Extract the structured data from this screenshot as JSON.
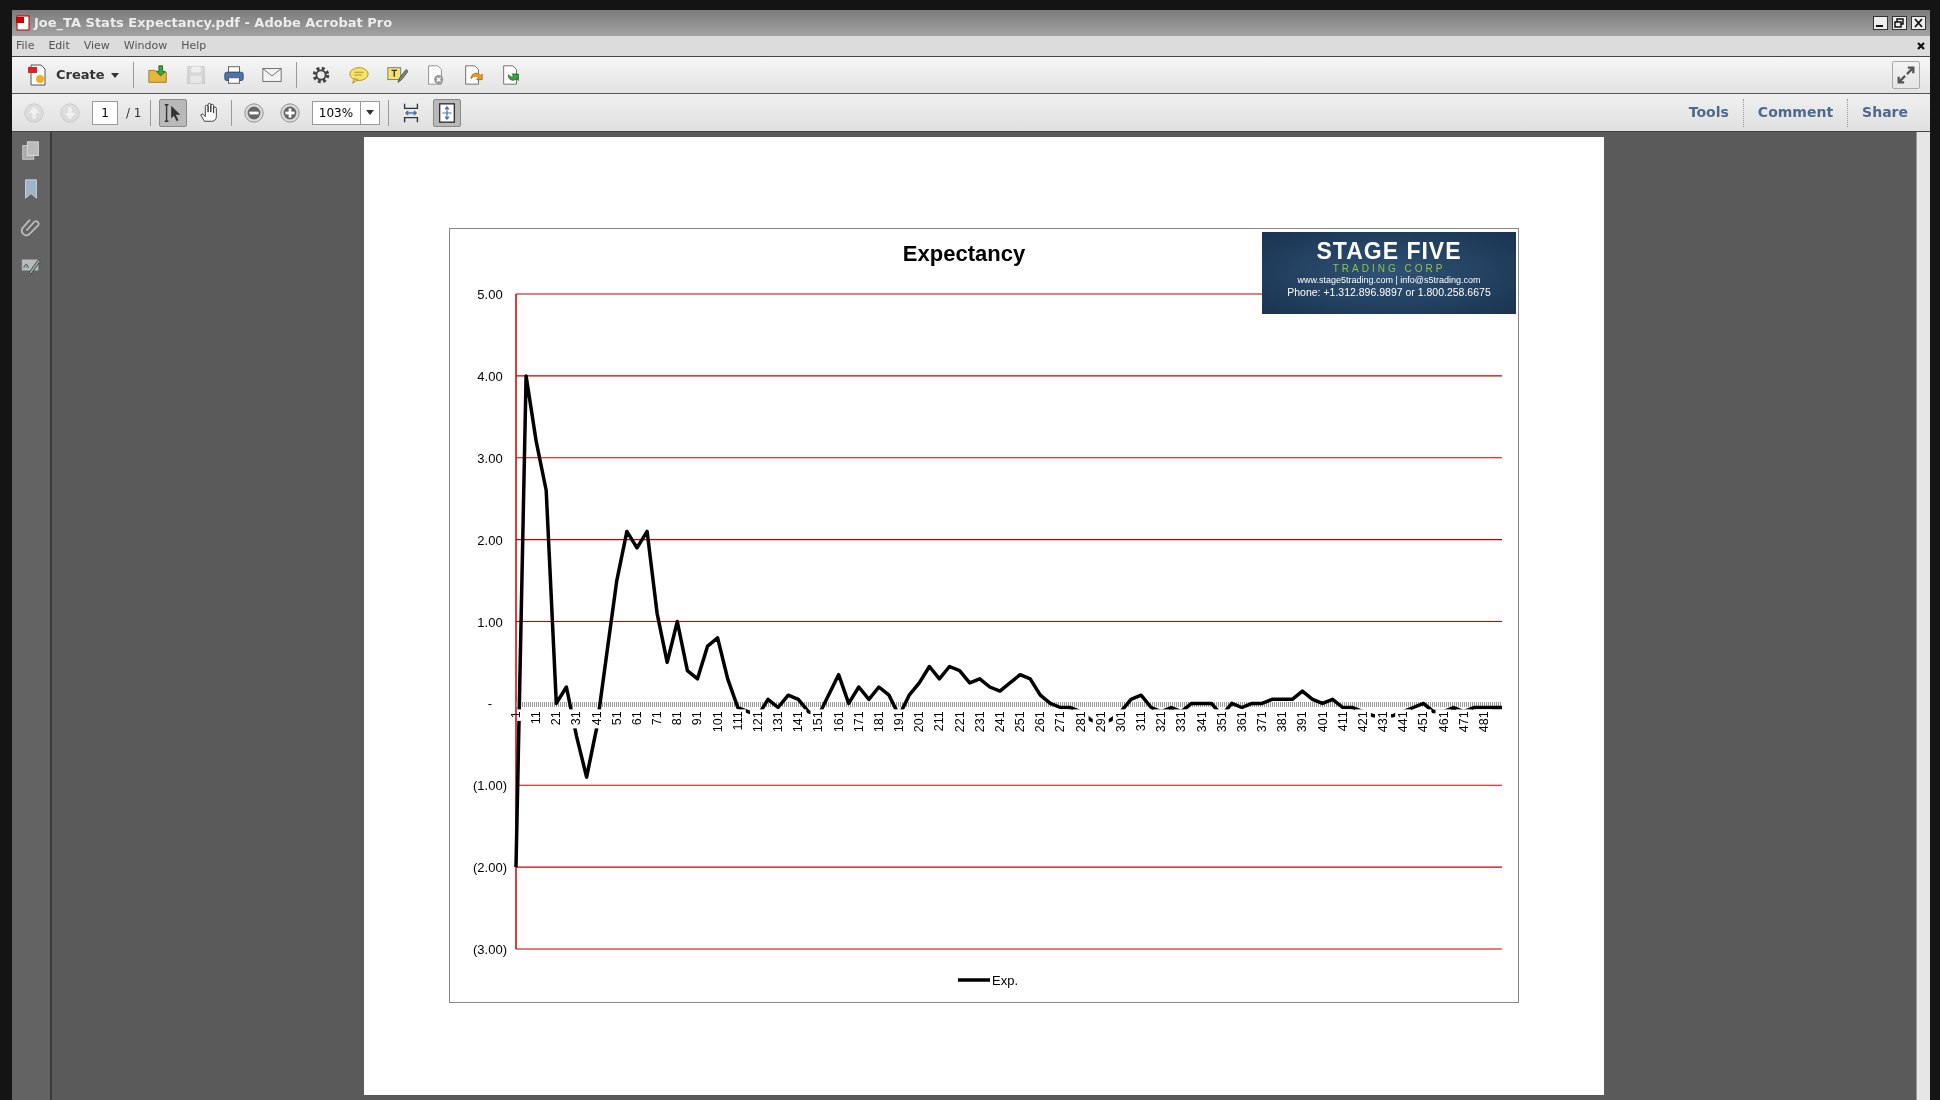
{
  "window": {
    "title": "Joe_TA Stats Expectancy.pdf - Adobe Acrobat Pro"
  },
  "menu": [
    "File",
    "Edit",
    "View",
    "Window",
    "Help"
  ],
  "toolbar": {
    "create_label": "Create",
    "tools": [
      {
        "kind": "open",
        "disabled": false
      },
      {
        "kind": "save",
        "disabled": true
      },
      {
        "kind": "print",
        "disabled": false
      },
      {
        "kind": "email",
        "disabled": false
      },
      {
        "kind": "settings",
        "disabled": false
      },
      {
        "kind": "comment",
        "disabled": false
      },
      {
        "kind": "sign",
        "disabled": false
      },
      {
        "kind": "delete",
        "disabled": false
      },
      {
        "kind": "export",
        "disabled": false
      },
      {
        "kind": "send",
        "disabled": false
      }
    ]
  },
  "navigation": {
    "page_buttons": [
      {
        "kind": "previous",
        "disabled": true
      },
      {
        "kind": "next",
        "disabled": true
      }
    ],
    "page": "1",
    "page_total": "/ 1",
    "view_tools": [
      {
        "kind": "select",
        "selected": true
      },
      {
        "kind": "hand",
        "selected": false
      }
    ],
    "zoom": "103%",
    "fit_buttons": [
      {
        "kind": "fit-width",
        "selected": false
      },
      {
        "kind": "fit-page",
        "selected": true
      }
    ]
  },
  "panels": [
    "Tools",
    "Comment",
    "Share"
  ],
  "sidebar": [
    {
      "kind": "pages"
    },
    {
      "kind": "bookmarks"
    },
    {
      "kind": "attachments"
    },
    {
      "kind": "signatures"
    }
  ],
  "chart": {
    "logo": {
      "title": "STAGE FIVE",
      "subtitle": "TRADING CORP",
      "contact": "www.stage5trading.com | info@s5trading.com",
      "phone": "Phone: +1.312.896.9897 or 1.800.258.6675"
    },
    "chart_data": {
      "type": "line",
      "title": "Expectancy",
      "x": [
        1,
        6,
        11,
        16,
        21,
        26,
        31,
        36,
        41,
        46,
        51,
        56,
        61,
        66,
        71,
        76,
        81,
        86,
        91,
        96,
        101,
        106,
        111,
        116,
        121,
        126,
        131,
        136,
        141,
        146,
        151,
        156,
        161,
        166,
        171,
        176,
        181,
        186,
        191,
        196,
        201,
        206,
        211,
        216,
        221,
        226,
        231,
        236,
        241,
        246,
        251,
        256,
        261,
        266,
        271,
        276,
        281,
        286,
        291,
        296,
        301,
        306,
        311,
        316,
        321,
        326,
        331,
        336,
        341,
        346,
        351,
        356,
        361,
        366,
        371,
        376,
        381,
        386,
        391,
        396,
        401,
        406,
        411,
        416,
        421,
        426,
        431,
        436,
        441,
        446,
        451,
        456,
        461,
        466,
        471,
        476,
        481,
        486,
        490
      ],
      "series": [
        {
          "name": "Exp.",
          "color": "#000000",
          "values": [
            -2.0,
            4.0,
            3.2,
            2.6,
            0.0,
            0.2,
            -0.4,
            -0.9,
            -0.3,
            0.6,
            1.5,
            2.1,
            1.9,
            2.1,
            1.1,
            0.5,
            1.0,
            0.4,
            0.3,
            0.7,
            0.8,
            0.3,
            -0.05,
            -0.1,
            -0.15,
            0.05,
            -0.05,
            0.1,
            0.05,
            -0.1,
            -0.15,
            0.1,
            0.35,
            0.0,
            0.2,
            0.05,
            0.2,
            0.1,
            -0.15,
            0.1,
            0.25,
            0.45,
            0.3,
            0.45,
            0.4,
            0.25,
            0.3,
            0.2,
            0.15,
            0.25,
            0.35,
            0.3,
            0.1,
            0.0,
            -0.05,
            -0.05,
            -0.1,
            -0.2,
            -0.25,
            -0.2,
            -0.1,
            0.05,
            0.1,
            -0.05,
            -0.1,
            -0.05,
            -0.1,
            0.0,
            0.0,
            0.0,
            -0.15,
            0.0,
            -0.05,
            0.0,
            0.0,
            0.05,
            0.05,
            0.05,
            0.15,
            0.05,
            0.0,
            0.05,
            -0.05,
            -0.05,
            -0.1,
            -0.15,
            -0.15,
            -0.15,
            -0.1,
            -0.05,
            0.0,
            -0.1,
            -0.1,
            -0.05,
            -0.1,
            -0.05,
            -0.05,
            -0.05,
            -0.05
          ]
        }
      ],
      "grid": true,
      "ref_lines": [
        {
          "axis": "y",
          "value": 0,
          "color": "#999999"
        }
      ],
      "xlim": [
        1,
        490
      ],
      "ylim": [
        -3,
        5
      ],
      "xticks": [
        1,
        11,
        21,
        31,
        41,
        51,
        61,
        71,
        81,
        91,
        101,
        111,
        121,
        131,
        141,
        151,
        161,
        171,
        181,
        191,
        201,
        211,
        221,
        231,
        241,
        251,
        261,
        271,
        281,
        291,
        301,
        311,
        321,
        331,
        341,
        351,
        361,
        371,
        381,
        391,
        401,
        411,
        421,
        431,
        441,
        451,
        461,
        471,
        481
      ],
      "yticks": [
        {
          "value": 5,
          "label": "5.00"
        },
        {
          "value": 4,
          "label": "4.00"
        },
        {
          "value": 3,
          "label": "3.00"
        },
        {
          "value": 2,
          "label": "2.00"
        },
        {
          "value": 1,
          "label": "1.00"
        },
        {
          "value": 0,
          "label": "-"
        },
        {
          "value": -1,
          "label": "(1.00)"
        },
        {
          "value": -2,
          "label": "(2.00)"
        },
        {
          "value": -3,
          "label": "(3.00)"
        }
      ]
    }
  }
}
